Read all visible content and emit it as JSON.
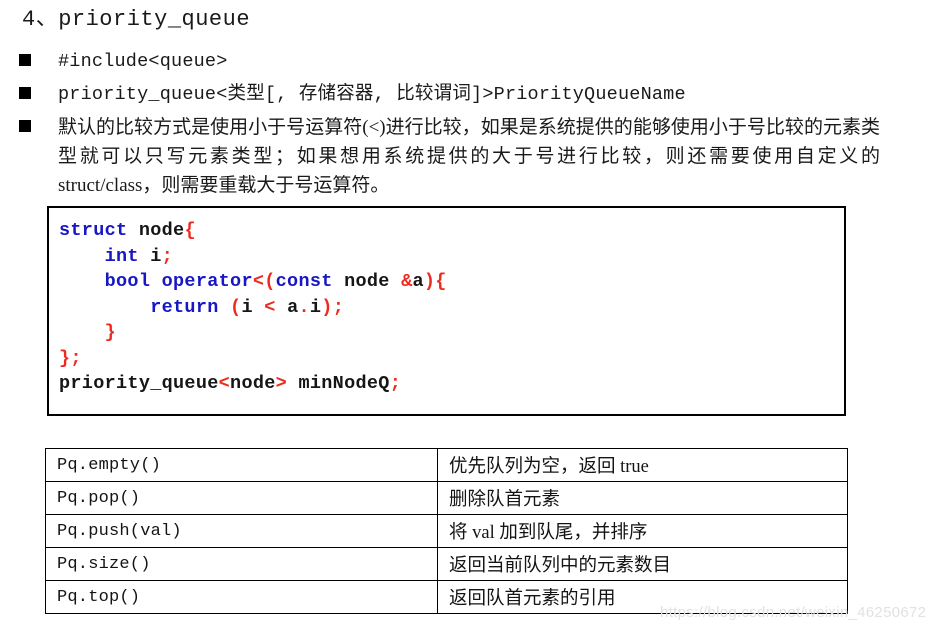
{
  "slide": {
    "title": "4、priority_queue"
  },
  "bullets": [
    {
      "marker": "square-bullet",
      "kind": "mono",
      "text": "#include<queue>"
    },
    {
      "marker": "square-bullet",
      "kind": "mono",
      "text": "priority_queue<类型[, 存储容器, 比较谓词]>PriorityQueueName"
    },
    {
      "marker": "square-bullet",
      "kind": "paragraph",
      "text": "默认的比较方式是使用小于号运算符(<)进行比较，如果是系统提供的能够使用小于号比较的元素类型就可以只写元素类型；如果想用系统提供的大于号进行比较，则还需要使用自定义的 struct/class，则需要重载大于号运算符。"
    }
  ],
  "code_block": {
    "language": "cpp",
    "colors": {
      "keyword": "#1717c4",
      "punctuation": "#ee2a1f",
      "identifier": "#161616",
      "border": "#000000",
      "background": "#ffffff"
    },
    "lines": [
      {
        "tokens": [
          {
            "t": "struct",
            "c": "kw"
          },
          {
            "t": " ",
            "c": "idn"
          },
          {
            "t": "node",
            "c": "idn"
          },
          {
            "t": "{",
            "c": "pun"
          }
        ]
      },
      {
        "tokens": [
          {
            "t": "    ",
            "c": "idn"
          },
          {
            "t": "int",
            "c": "kw"
          },
          {
            "t": " ",
            "c": "idn"
          },
          {
            "t": "i",
            "c": "idn"
          },
          {
            "t": ";",
            "c": "pun"
          }
        ]
      },
      {
        "tokens": [
          {
            "t": "    ",
            "c": "idn"
          },
          {
            "t": "bool",
            "c": "kw"
          },
          {
            "t": " ",
            "c": "idn"
          },
          {
            "t": "operator",
            "c": "kw"
          },
          {
            "t": "<(",
            "c": "pun"
          },
          {
            "t": "const",
            "c": "kw"
          },
          {
            "t": " node ",
            "c": "idn"
          },
          {
            "t": "&",
            "c": "pun"
          },
          {
            "t": "a",
            "c": "idn"
          },
          {
            "t": "){",
            "c": "pun"
          }
        ]
      },
      {
        "tokens": [
          {
            "t": "        ",
            "c": "idn"
          },
          {
            "t": "return",
            "c": "kw"
          },
          {
            "t": " ",
            "c": "idn"
          },
          {
            "t": "(",
            "c": "pun"
          },
          {
            "t": "i ",
            "c": "idn"
          },
          {
            "t": "<",
            "c": "pun"
          },
          {
            "t": " a",
            "c": "idn"
          },
          {
            "t": ".",
            "c": "pun"
          },
          {
            "t": "i",
            "c": "idn"
          },
          {
            "t": ");",
            "c": "pun"
          }
        ]
      },
      {
        "tokens": [
          {
            "t": "    ",
            "c": "idn"
          },
          {
            "t": "}",
            "c": "pun"
          }
        ]
      },
      {
        "tokens": [
          {
            "t": "};",
            "c": "pun"
          }
        ]
      },
      {
        "tokens": [
          {
            "t": "priority_queue",
            "c": "idn"
          },
          {
            "t": "<",
            "c": "pun"
          },
          {
            "t": "node",
            "c": "idn"
          },
          {
            "t": ">",
            "c": "pun"
          },
          {
            "t": " minNodeQ",
            "c": "idn"
          },
          {
            "t": ";",
            "c": "pun"
          }
        ]
      }
    ]
  },
  "api_table": {
    "rows": [
      {
        "api": "Pq.empty()",
        "desc": "优先队列为空，返回 true"
      },
      {
        "api": "Pq.pop()",
        "desc": "删除队首元素"
      },
      {
        "api": "Pq.push(val)",
        "desc": "将 val 加到队尾，并排序"
      },
      {
        "api": "Pq.size()",
        "desc": "返回当前队列中的元素数目"
      },
      {
        "api": "Pq.top()",
        "desc": "返回队首元素的引用"
      }
    ]
  },
  "watermark": {
    "text": "https://blog.csdn.net/weixin_46250672"
  }
}
